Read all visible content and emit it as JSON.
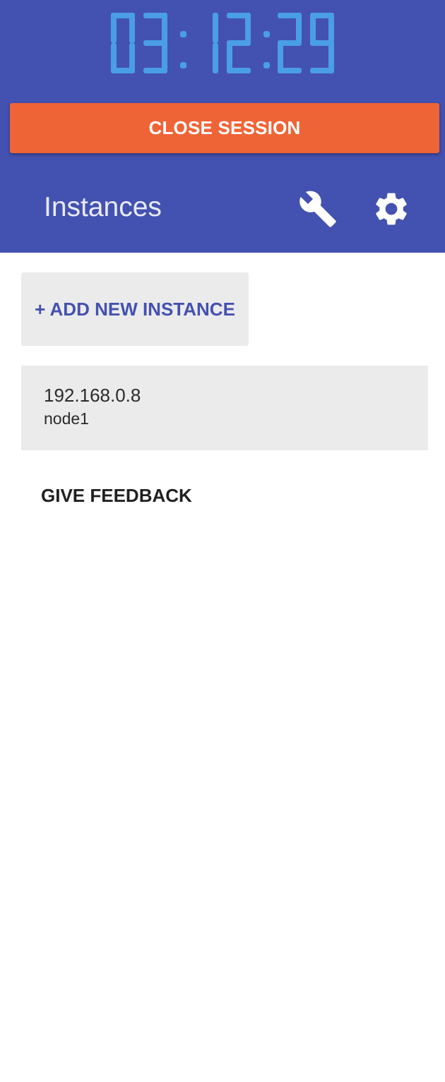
{
  "session": {
    "timer": "03:12:29",
    "close_label": "CLOSE SESSION"
  },
  "toolbar": {
    "title": "Instances",
    "icons": [
      "wrench-icon",
      "gear-icon"
    ]
  },
  "main": {
    "add_label": "+ ADD NEW INSTANCE",
    "instances": [
      {
        "ip": "192.168.0.8",
        "name": "node1"
      }
    ],
    "feedback_label": "GIVE FEEDBACK"
  },
  "colors": {
    "header_bg": "#4351b0",
    "timer": "#4a9ee6",
    "close_button": "#ef6436",
    "accent_text": "#4351b0",
    "card_bg": "#ebebeb"
  }
}
